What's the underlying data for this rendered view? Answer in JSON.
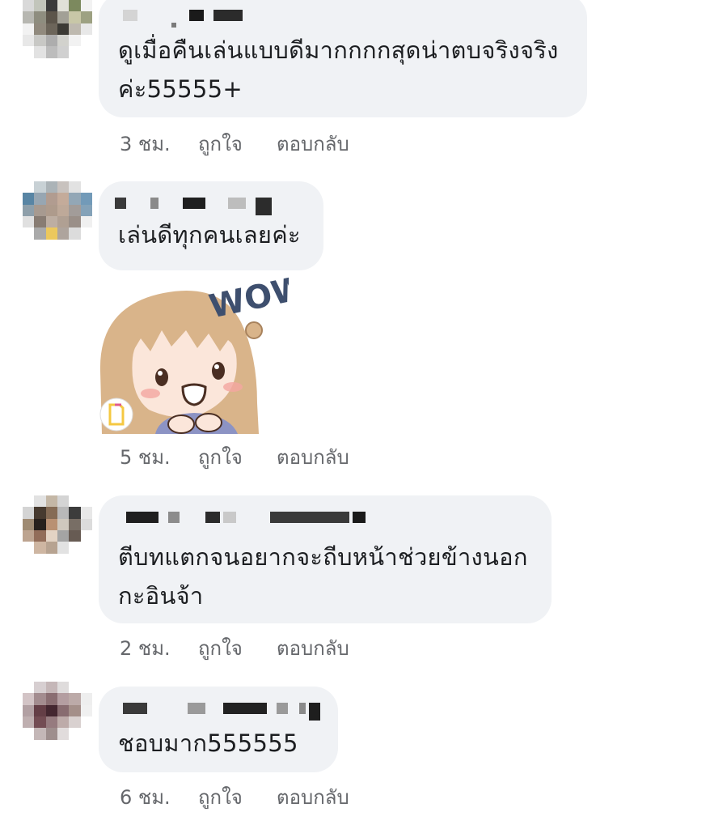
{
  "comments": [
    {
      "text": "ดูเมื่อคืนเล่นแบบดีมากกกกสุดน่าตบจริงจริง\nค่ะ55555+",
      "time": "3 ชม.",
      "like_label": "ถูกใจ",
      "reply_label": "ตอบกลับ"
    },
    {
      "text": "เล่นดีทุกคนเลยค่ะ",
      "time": "5 ชม.",
      "like_label": "ถูกใจ",
      "reply_label": "ตอบกลับ",
      "sticker_text": "WOW"
    },
    {
      "text": "ตีบทแตกจนอยากจะถีบหน้าช่วยข้างนอก\nกะอินจ้า",
      "time": "2 ชม.",
      "like_label": "ถูกใจ",
      "reply_label": "ตอบกลับ"
    },
    {
      "text": "ชอบมาก555555",
      "time": "6 ชม.",
      "like_label": "ถูกใจ",
      "reply_label": "ตอบกลับ"
    }
  ],
  "colors": {
    "bubble": "#f0f2f5",
    "text": "#1c1e21",
    "meta": "#65676b"
  }
}
